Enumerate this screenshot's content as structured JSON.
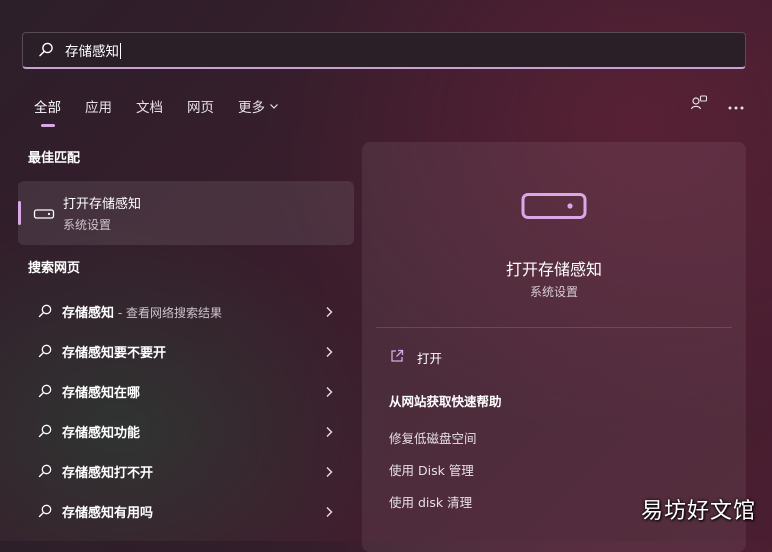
{
  "search": {
    "value": "存储感知"
  },
  "tabs": [
    {
      "label": "全部",
      "active": true
    },
    {
      "label": "应用"
    },
    {
      "label": "文档"
    },
    {
      "label": "网页"
    },
    {
      "label": "更多"
    }
  ],
  "best_match": {
    "heading": "最佳匹配",
    "title": "打开存储感知",
    "subtitle": "系统设置",
    "icon": "storage-drive-icon"
  },
  "web_search": {
    "heading": "搜索网页",
    "results": [
      {
        "text": "存储感知",
        "suffix": " - 查看网络搜索结果"
      },
      {
        "text": "存储感知要不要开",
        "suffix": ""
      },
      {
        "text": "存储感知在哪",
        "suffix": ""
      },
      {
        "text": "存储感知功能",
        "suffix": ""
      },
      {
        "text": "存储感知打不开",
        "suffix": ""
      },
      {
        "text": "存储感知有用吗",
        "suffix": ""
      }
    ]
  },
  "preview": {
    "title": "打开存储感知",
    "subtitle": "系统设置",
    "open_label": "打开",
    "help_heading": "从网站获取快速帮助",
    "links": [
      "修复低磁盘空间",
      "使用 Disk 管理",
      "使用 disk 清理"
    ]
  },
  "watermark": "易坊好文馆",
  "colors": {
    "accent": "#d9a8e6",
    "background": "#3a1d2c"
  }
}
